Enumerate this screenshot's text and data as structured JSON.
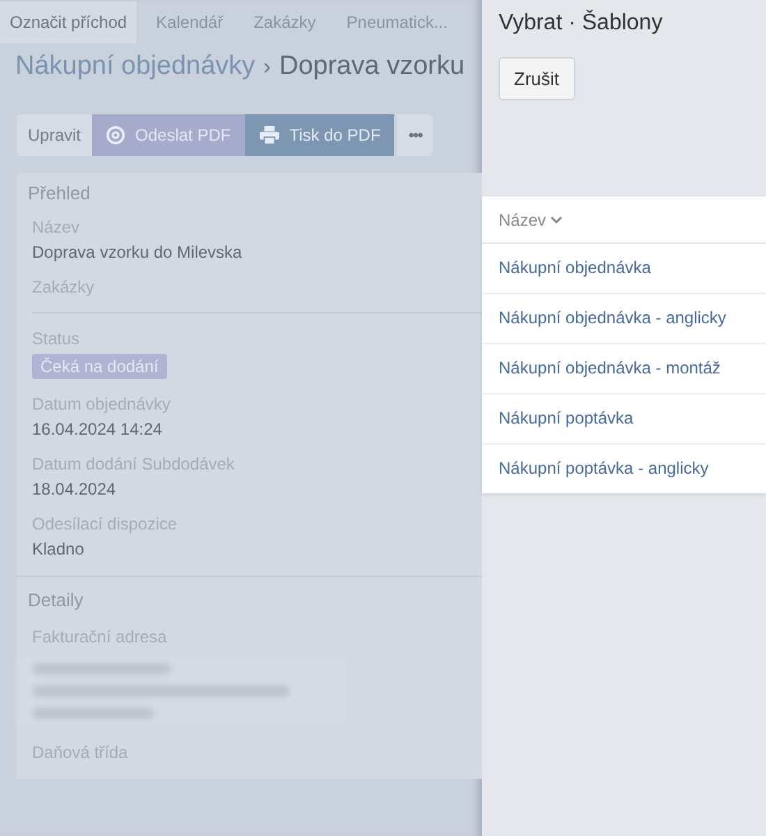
{
  "top_tabs": [
    {
      "label": "Označit příchod",
      "selected": true
    },
    {
      "label": "Kalendář",
      "selected": false
    },
    {
      "label": "Zakázky",
      "selected": false
    },
    {
      "label": "Pneumatick...",
      "selected": false
    }
  ],
  "breadcrumb": {
    "parent": "Nákupní objednávky",
    "separator": "›",
    "current": "Doprava vzorku"
  },
  "toolbar": [
    {
      "label": "Upravit",
      "kind": "plain"
    },
    {
      "label": "Odeslat PDF",
      "kind": "email"
    },
    {
      "label": "Tisk do PDF",
      "kind": "print"
    },
    {
      "label": "•••",
      "kind": "more"
    }
  ],
  "overview": {
    "title": "Přehled",
    "fields": [
      {
        "label": "Název",
        "value": "Doprava vzorku do Milevska",
        "kind": "text"
      },
      {
        "label": "Zakázky",
        "kind": "empty"
      },
      {
        "label": "Status",
        "value": "Čeká na dodání",
        "kind": "badge"
      },
      {
        "label": "Datum objednávky",
        "value": "16.04.2024 14:24",
        "kind": "text"
      },
      {
        "label": "Datum dodání Subdodávek",
        "value": "18.04.2024",
        "kind": "text"
      },
      {
        "label": "Odesílací dispozice",
        "value": "Kladno",
        "kind": "text"
      }
    ]
  },
  "details": {
    "title": "Detaily",
    "fields": [
      {
        "label": "Fakturační adresa",
        "kind": "redacted"
      },
      {
        "label": "Daňová třída",
        "kind": "empty"
      }
    ]
  },
  "dialog": {
    "title": "Vybrat · Šablony",
    "cancel": "Zrušit",
    "column": "Název",
    "rows": [
      "Nákupní objednávka",
      "Nákupní objednávka - anglicky",
      "Nákupní objednávka - montáž",
      "Nákupní poptávka",
      "Nákupní poptávka - anglicky"
    ]
  }
}
